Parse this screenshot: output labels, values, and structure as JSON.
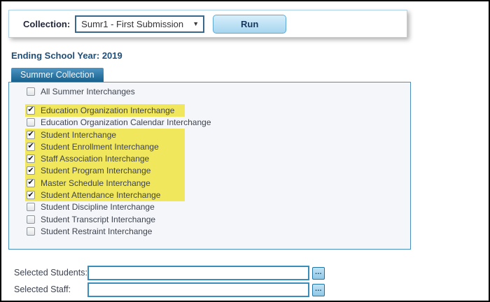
{
  "header": {
    "collection_label": "Collection:",
    "collection_value": "Sumr1 - First Submission",
    "run_label": "Run"
  },
  "school_year": {
    "label": "Ending School Year:",
    "value": "2019"
  },
  "tab_label": "Summer Collection",
  "interchange_list": [
    {
      "label": "All Summer Interchanges",
      "checked": false,
      "highlighted": false,
      "gap_before": false
    },
    {
      "label": "Education Organization Interchange",
      "checked": true,
      "highlighted": true,
      "gap_before": true
    },
    {
      "label": "Education Organization Calendar Interchange",
      "checked": false,
      "highlighted": false,
      "gap_before": false
    },
    {
      "label": "Student Interchange",
      "checked": true,
      "highlighted": true,
      "gap_before": false
    },
    {
      "label": "Student Enrollment Interchange",
      "checked": true,
      "highlighted": true,
      "gap_before": false
    },
    {
      "label": "Staff Association Interchange",
      "checked": true,
      "highlighted": true,
      "gap_before": false
    },
    {
      "label": "Student Program Interchange",
      "checked": true,
      "highlighted": true,
      "gap_before": false
    },
    {
      "label": "Master Schedule Interchange",
      "checked": true,
      "highlighted": true,
      "gap_before": false
    },
    {
      "label": "Student Attendance Interchange",
      "checked": true,
      "highlighted": true,
      "gap_before": false
    },
    {
      "label": "Student Discipline Interchange",
      "checked": false,
      "highlighted": false,
      "gap_before": false
    },
    {
      "label": "Student Transcript Interchange",
      "checked": false,
      "highlighted": false,
      "gap_before": false
    },
    {
      "label": "Student Restraint Interchange",
      "checked": false,
      "highlighted": false,
      "gap_before": false
    }
  ],
  "footer_fields": [
    {
      "label": "Selected Students:",
      "value": ""
    },
    {
      "label": "Selected Staff:",
      "value": ""
    }
  ],
  "icons": {
    "dropdown_arrow": "▼",
    "check": "✔",
    "ellipsis": "..."
  },
  "colors": {
    "highlight_yellow": "#f0e75c",
    "tab_blue_bottom": "#16618f",
    "panel_border": "#4a90bf",
    "accent_blue": "#2d7fb8"
  }
}
